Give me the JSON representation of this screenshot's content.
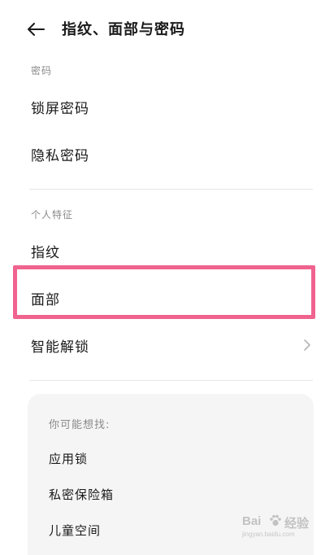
{
  "header": {
    "back_icon": "arrow-left-icon",
    "title": "指纹、面部与密码"
  },
  "sections": {
    "password": {
      "label": "密码",
      "items": [
        "锁屏密码",
        "隐私密码"
      ]
    },
    "personal": {
      "label": "个人特征",
      "items": [
        "指纹",
        "面部",
        "智能解锁"
      ]
    }
  },
  "suggestions": {
    "title": "你可能想找:",
    "items": [
      "应用锁",
      "私密保险箱",
      "儿童空间"
    ]
  },
  "highlight": {
    "target": "面部",
    "color": "#f0638f"
  },
  "watermark": {
    "text": "Bai",
    "text2": "经验",
    "url": "jingyan.baidu.com"
  },
  "colors": {
    "background": "#ffffff",
    "card": "#f5f5f5",
    "secondary_text": "#8a8a8a",
    "highlight": "#f0638f"
  }
}
